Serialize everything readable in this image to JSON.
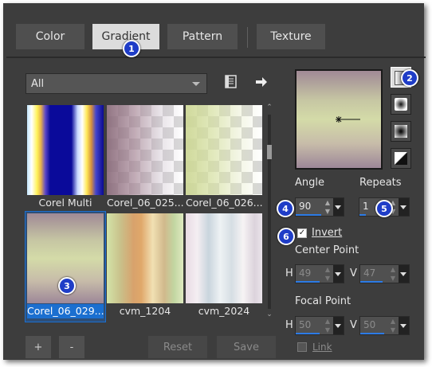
{
  "tabs": [
    {
      "label": "Color"
    },
    {
      "label": "Gradient",
      "active": true
    },
    {
      "label": "Pattern"
    },
    {
      "label": "Texture"
    }
  ],
  "category_dropdown": {
    "value": "All"
  },
  "gradients": [
    {
      "label": "Corel Multi"
    },
    {
      "label": "Corel_06_025..."
    },
    {
      "label": "Corel_06_026..."
    },
    {
      "label": "Corel_06_029...",
      "selected": true
    },
    {
      "label": "cvm_1204"
    },
    {
      "label": "cvm_2024"
    }
  ],
  "controls": {
    "angle_label": "Angle",
    "angle_value": "90",
    "repeats_label": "Repeats",
    "repeats_value": "1",
    "invert_label": "Invert",
    "invert_checked": true,
    "center_label": "Center Point",
    "center_h": "49",
    "center_v": "47",
    "focal_label": "Focal Point",
    "focal_h": "50",
    "focal_v": "50",
    "h_label": "H",
    "v_label": "V",
    "link_label": "Link"
  },
  "buttons": {
    "add": "+",
    "remove": "-",
    "reset": "Reset",
    "save": "Save"
  },
  "badges": [
    "1",
    "2",
    "3",
    "4",
    "5",
    "6"
  ],
  "colors": {
    "accent": "#1b6fd0",
    "badge": "#1f3dc7",
    "panel": "#3d3d3d"
  }
}
